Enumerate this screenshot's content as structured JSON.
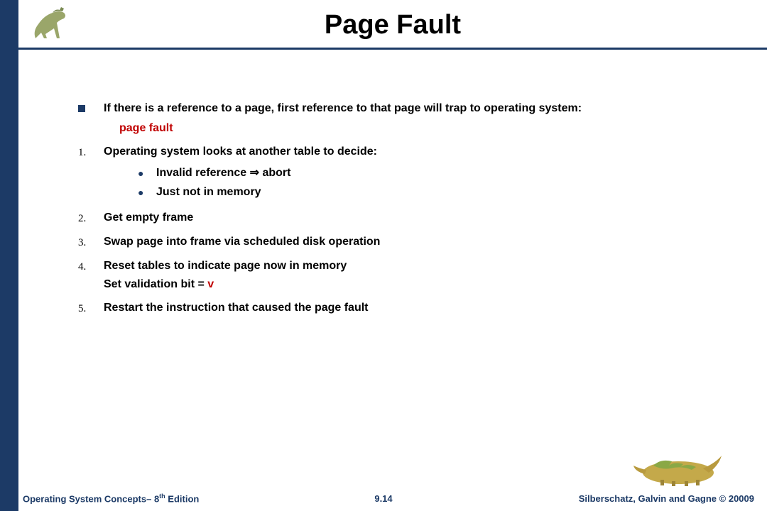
{
  "title": "Page Fault",
  "intro": {
    "line": "If there is a reference to a page, first reference to that page will trap to operating system:",
    "pagefault": "page fault"
  },
  "steps": [
    {
      "num": "1.",
      "text": "Operating system looks at another table to decide:",
      "subs": [
        "Invalid reference ⇒ abort",
        "Just not in memory"
      ]
    },
    {
      "num": "2.",
      "text": "Get empty frame"
    },
    {
      "num": "3.",
      "text": "Swap page into frame via scheduled disk operation"
    },
    {
      "num": "4.",
      "text": "Reset tables to indicate page now in memory",
      "line2": "Set validation bit = ",
      "vbit": "v"
    },
    {
      "num": "5.",
      "text": "Restart the instruction that caused the page fault"
    }
  ],
  "footer": {
    "left_a": "Operating System Concepts– 8",
    "left_sup": "th",
    "left_b": " Edition",
    "center": "9.14",
    "right": "Silberschatz, Galvin and Gagne © 20009"
  }
}
